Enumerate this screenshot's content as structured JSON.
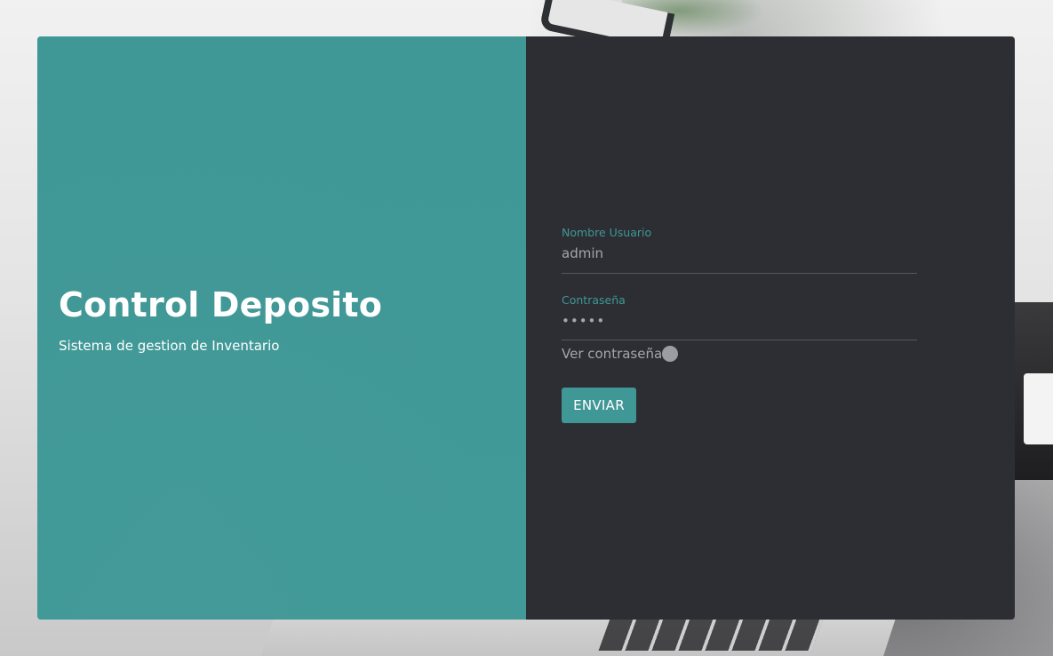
{
  "brand": {
    "title": "Control Deposito",
    "subtitle": "Sistema de gestion de Inventario"
  },
  "login_form": {
    "username_label": "Nombre Usuario",
    "username_value": "admin",
    "password_label": "Contraseña",
    "password_value": "admin",
    "show_password_label": "Ver contraseña",
    "show_password_enabled": false,
    "submit_label": "ENVIAR"
  },
  "colors": {
    "accent": "#3f9796",
    "form_panel": "#2d2e33",
    "input_text": "#a5a6aa",
    "toggle_knob": "#9c9da2"
  }
}
